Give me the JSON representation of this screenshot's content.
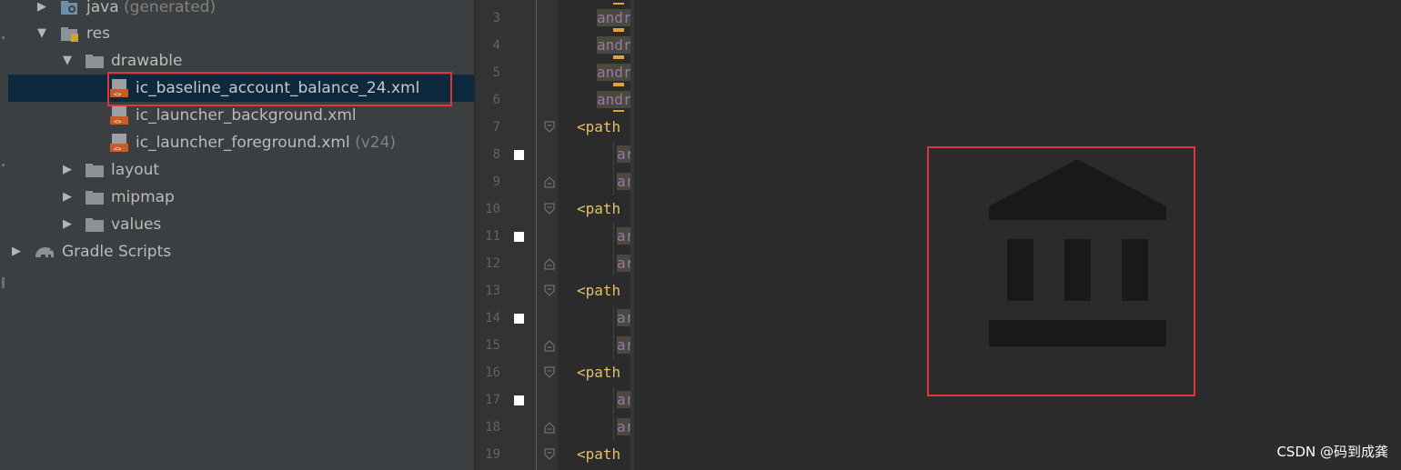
{
  "project_tree": {
    "items": [
      {
        "label": "java",
        "suffix": "(generated)"
      },
      {
        "label": "res",
        "suffix": ""
      },
      {
        "label": "drawable",
        "suffix": ""
      },
      {
        "label": "ic_baseline_account_balance_24.xml",
        "suffix": ""
      },
      {
        "label": "ic_launcher_background.xml",
        "suffix": ""
      },
      {
        "label": "ic_launcher_foreground.xml",
        "suffix": "(v24)"
      },
      {
        "label": "layout",
        "suffix": ""
      },
      {
        "label": "mipmap",
        "suffix": ""
      },
      {
        "label": "values",
        "suffix": ""
      },
      {
        "label": "Gradle Scripts",
        "suffix": ""
      }
    ]
  },
  "editor": {
    "line_numbers": [
      "3",
      "4",
      "5",
      "6",
      "7",
      "8",
      "9",
      "10",
      "11",
      "12",
      "13",
      "14",
      "15",
      "16",
      "17",
      "18",
      "19"
    ],
    "code_lines": [
      "andr",
      "andr",
      "andr",
      "andr",
      "<path",
      "ar",
      "ar",
      "<path",
      "ar",
      "ar",
      "<path",
      "ar",
      "ar",
      "<path",
      "ar",
      "ar",
      "<path"
    ]
  },
  "preview": {
    "icon": "account-balance-icon",
    "icon_color": "#191a18"
  },
  "colors": {
    "highlight": "#e0353b",
    "selection": "#0d293e",
    "tag": "#e8bf6a",
    "attribute": "#9876aa"
  },
  "watermark": "CSDN @码到成龚"
}
